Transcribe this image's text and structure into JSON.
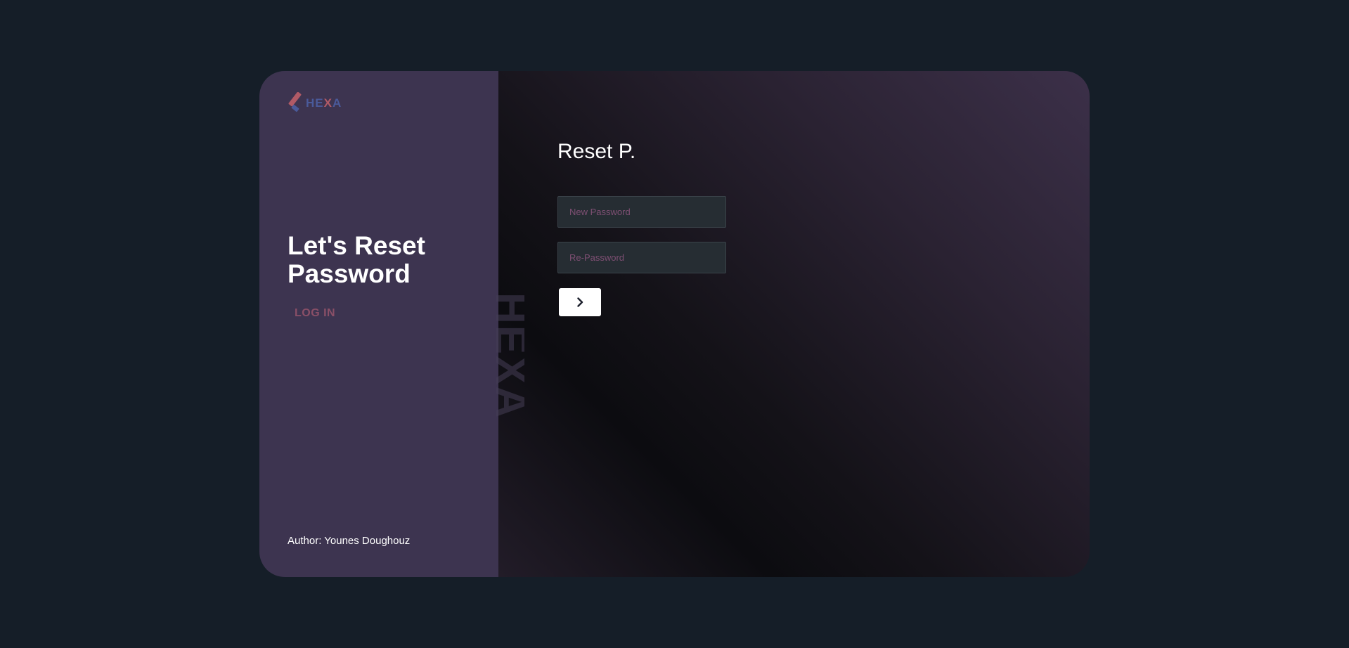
{
  "brand": {
    "name_prefix": "HE",
    "name_x": "X",
    "name_suffix": "A",
    "watermark": "HEXA"
  },
  "sidebar": {
    "headline": "Let's Reset Password",
    "login_link": "LOG IN",
    "author": "Author: Younes Doughouz"
  },
  "form": {
    "title": "Reset P.",
    "new_password_placeholder": "New Password",
    "new_password_value": "",
    "re_password_placeholder": "Re-Password",
    "re_password_value": "",
    "submit_icon": "chevron-right-icon"
  },
  "colors": {
    "page_bg": "#151e28",
    "sidebar_bg": "#3d3450",
    "accent_red": "#b05a66",
    "accent_blue": "#4a5a9a",
    "link": "#8a4f67",
    "placeholder": "#7e4f73"
  }
}
